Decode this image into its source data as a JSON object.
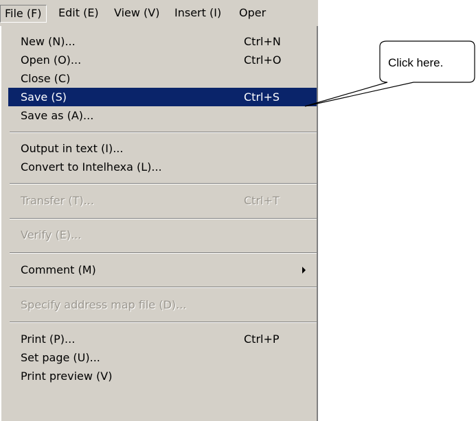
{
  "menubar": {
    "items": [
      {
        "label": "File (F)"
      },
      {
        "label": "Edit (E)"
      },
      {
        "label": "View (V)"
      },
      {
        "label": "Insert (I)"
      },
      {
        "label": "Oper"
      }
    ]
  },
  "file_menu": {
    "items": [
      {
        "label": "New (N)...",
        "shortcut": "Ctrl+N"
      },
      {
        "label": "Open (O)...",
        "shortcut": "Ctrl+O"
      },
      {
        "label": "Close (C)",
        "shortcut": ""
      },
      {
        "label": "Save (S)",
        "shortcut": "Ctrl+S",
        "state": "highlighted"
      },
      {
        "label": "Save as (A)...",
        "shortcut": ""
      },
      {
        "label": "Output in text (I)...",
        "shortcut": ""
      },
      {
        "label": "Convert to Intelhexa (L)...",
        "shortcut": ""
      },
      {
        "label": "Transfer (T)...",
        "shortcut": "Ctrl+T",
        "state": "disabled"
      },
      {
        "label": "Verify (E)...",
        "shortcut": "",
        "state": "disabled"
      },
      {
        "label": "Comment (M)",
        "shortcut": "",
        "submenu": true
      },
      {
        "label": "Specify address map file (D)...",
        "shortcut": "",
        "state": "disabled"
      },
      {
        "label": "Print (P)...",
        "shortcut": "Ctrl+P"
      },
      {
        "label": "Set page (U)...",
        "shortcut": ""
      },
      {
        "label": "Print preview (V)",
        "shortcut": ""
      }
    ]
  },
  "callout": {
    "text": "Click here."
  },
  "colors": {
    "menu_bg": "#d4d0c8",
    "highlight": "#0a246a",
    "disabled_text": "#9a968e"
  }
}
